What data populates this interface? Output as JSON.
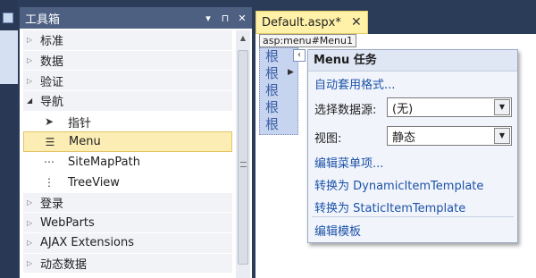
{
  "toolbox": {
    "title": "工具箱",
    "pin_glyph": "▾ ⊓",
    "close_glyph": "✕",
    "rows": [
      {
        "type": "cat",
        "label": "标准",
        "open": false
      },
      {
        "type": "cat",
        "label": "数据",
        "open": false
      },
      {
        "type": "cat",
        "label": "验证",
        "open": false
      },
      {
        "type": "cat",
        "label": "导航",
        "open": true
      },
      {
        "type": "item",
        "label": "指针",
        "icon": "pointer-icon"
      },
      {
        "type": "item",
        "label": "Menu",
        "icon": "menu-control-icon",
        "selected": true
      },
      {
        "type": "item",
        "label": "SiteMapPath",
        "icon": "sitemappath-icon"
      },
      {
        "type": "item",
        "label": "TreeView",
        "icon": "treeview-icon"
      },
      {
        "type": "cat",
        "label": "登录",
        "open": false
      },
      {
        "type": "cat",
        "label": "WebParts",
        "open": false
      },
      {
        "type": "cat",
        "label": "AJAX Extensions",
        "open": false
      },
      {
        "type": "cat",
        "label": "动态数据",
        "open": false
      }
    ]
  },
  "document": {
    "tab_label": "Default.aspx*",
    "tab_close": "✕",
    "menu_tag": "asp:menu#Menu1",
    "root_items": [
      "根",
      "根",
      "根",
      "根",
      "根"
    ]
  },
  "tasks": {
    "title": "Menu 任务",
    "auto_format": "自动套用格式...",
    "datasource_label": "选择数据源:",
    "datasource_value": "(无)",
    "view_label": "视图:",
    "view_value": "静态",
    "edit_items": "编辑菜单项...",
    "convert_dynamic": "转换为 DynamicItemTemplate",
    "convert_static": "转换为 StaticItemTemplate",
    "edit_templates": "编辑模板"
  },
  "colors": {
    "titlebar": "#4d6082",
    "selected_item": "#fcedb4",
    "doc_tab": "#fff1a8",
    "link": "#1c52a8"
  }
}
